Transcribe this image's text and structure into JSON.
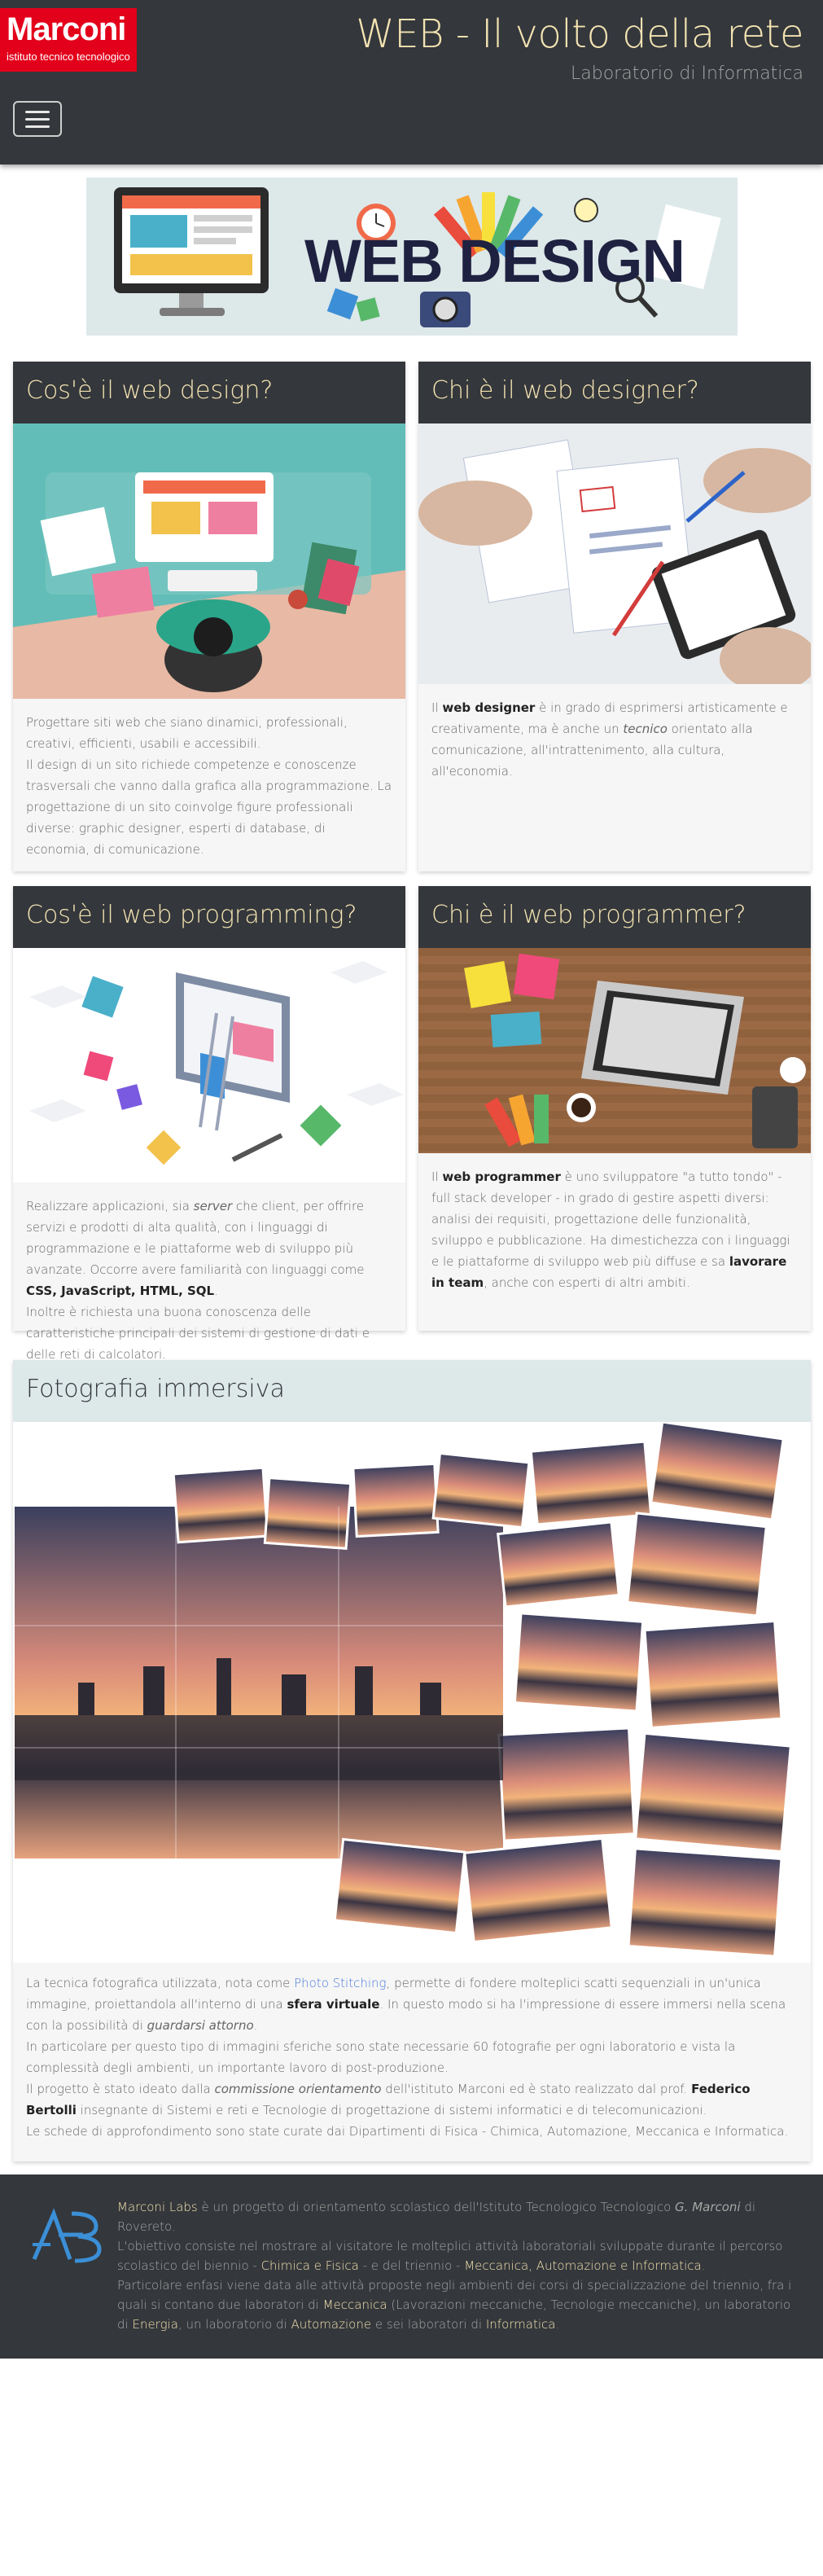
{
  "header": {
    "logo_name": "Marconi",
    "logo_subtitle": "istituto tecnico tecnologico",
    "title": "WEB - Il volto della rete",
    "subtitle": "Laboratorio di Informatica"
  },
  "banner": {
    "text": "WEB DESIGN"
  },
  "cards": {
    "web_design": {
      "title": "Cos'è il web design?",
      "p1": "Progettare siti web che siano dinamici, professionali, creativi, efficienti, usabili e accessibili.",
      "p2": "Il design di un sito richiede competenze e conoscenze trasversali che vanno dalla grafica alla programmazione. La progettazione di un sito coinvolge figure professionali diverse: graphic designer, esperti di database, di economia, di comunicazione."
    },
    "web_designer": {
      "title": "Chi è il web designer?",
      "t1": "Il ",
      "b1": "web designer",
      "t2": " è in grado di esprimersi artisticamente e creativamente, ma è anche un ",
      "i1": "tecnico",
      "t3": " orientato alla comunicazione, all'intrattenimento, alla cultura, all'economia."
    },
    "web_programming": {
      "title": "Cos'è il web programming?",
      "t1": "Realizzare applicazioni, sia ",
      "i1": "server",
      "t2": " che client, per offrire servizi e prodotti di alta qualità, con i linguaggi di programmazione e le piattaforme web di sviluppo più avanzate. Occorre avere familiarità con linguaggi come ",
      "b1": "CSS, JavaScript, HTML, SQL",
      "t3": ".",
      "p2": "Inoltre è richiesta una buona conoscenza delle caratteristiche principali dei sistemi di gestione di dati e delle reti di calcolatori."
    },
    "web_programmer": {
      "title": "Chi è il web programmer?",
      "t1": "Il ",
      "b1": "web programmer",
      "t2": " è uno sviluppatore \"a tutto tondo\" - full stack developer - in grado di gestire aspetti diversi: analisi dei requisiti, progettazione delle funzionalità, sviluppo e pubblicazione. Ha dimestichezza con i linguaggi e le piattaforme di sviluppo web più diffuse e sa ",
      "b2": "lavorare in team",
      "t3": ", anche con esperti di altri ambiti."
    },
    "photo": {
      "title": "Fotografia immersiva",
      "t1": "La tecnica fotografica utilizzata, nota come ",
      "link": "Photo Stitching",
      "t2": ", permette di fondere molteplici scatti sequenziali in un'unica immagine, proiettandola all'interno di una ",
      "b1": "sfera virtuale",
      "t3": ". In questo modo si ha l'impressione di essere immersi nella scena con la possibilità di ",
      "i1": "guardarsi attorno",
      "t4": ".",
      "p2": "In particolare per questo tipo di immagini sferiche sono state necessarie 60 fotografie per ogni laboratorio e vista la complessità degli ambienti, un importante lavoro di post-produzione.",
      "p3a": "Il progetto è stato ideato dalla ",
      "p3i": "commissione orientamento",
      "p3b": " dell'istituto Marconi ed è stato realizzato dal prof. ",
      "p3name": "Federico Bertolli",
      "p3c": " insegnante di Sistemi e reti e Tecnologie di progettazione di sistemi informatici e di telecomunicazioni.",
      "p4": "Le schede di approfondimento sono state curate dai Dipartimenti di Fisica - Chimica, Automazione, Meccanica e Informatica."
    }
  },
  "footer": {
    "brand": "Marconi Labs",
    "t1": " è un progetto di orientamento scolastico dell'Istituto Tecnologico Tecnologico ",
    "i1": "G. Marconi",
    "t2": " di Rovereto.",
    "t3": "L'obiettivo consiste nel mostrare al visitatore le molteplici attività laboratoriali sviluppate durante il percorso scolastico del biennio - ",
    "h1": "Chimica e Fisica",
    "t4": " - e del triennio - ",
    "h2": "Meccanica, Automazione e Informatica",
    "t5": ".",
    "t6": "Particolare enfasi viene data alle attività proposte negli ambienti dei corsi di specializzazione del triennio, fra i quali si contano due laboratori di ",
    "h3": "Meccanica",
    "t7": " (Lavorazioni meccaniche, Tecnologie meccaniche), un laboratorio di ",
    "h4": "Energia",
    "t8": ", un laboratorio di ",
    "h5": "Automazione",
    "t9": " e sei laboratori di ",
    "h6": "Informatica",
    "t10": "."
  },
  "colors": {
    "header_bg": "#34373b",
    "title_gold": "#f3e3b2",
    "logo_red": "#e3001b",
    "link_blue": "#4a7bd6"
  }
}
